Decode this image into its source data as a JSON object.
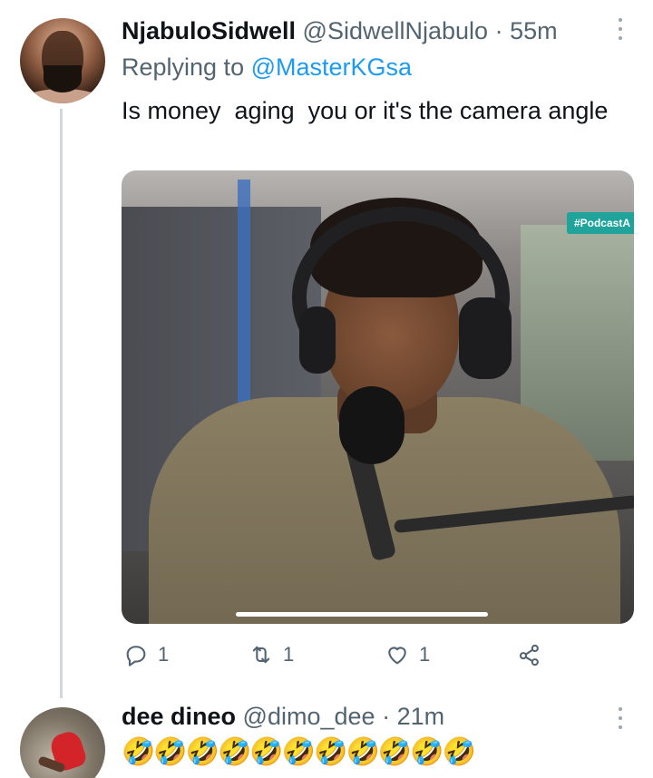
{
  "tweet": {
    "author_name": "NjabuloSidwell",
    "author_handle": "@SidwellNjabulo",
    "separator": "·",
    "time": "55m",
    "replying_prefix": "Replying to",
    "replying_to": "@MasterKGsa",
    "text": "Is money  aging  you or it's the camera angle",
    "media": {
      "hashtag_overlay": "#PodcastA"
    },
    "actions": {
      "reply_count": "1",
      "retweet_count": "1",
      "like_count": "1"
    },
    "icons": {
      "reply": "reply-bubble-icon",
      "retweet": "retweet-icon",
      "like": "heart-icon",
      "share": "share-icon",
      "more": "more-vertical-icon"
    }
  },
  "reply": {
    "author_name": "dee dineo",
    "author_handle": "@dimo_dee",
    "separator": "·",
    "time": "21m",
    "text": "🤣🤣🤣🤣🤣🤣🤣🤣🤣🤣🤣"
  },
  "colors": {
    "link": "#1d9bf0",
    "secondary_text": "#536471",
    "primary_text": "#0f1419",
    "thread_line": "#cfd9de"
  }
}
